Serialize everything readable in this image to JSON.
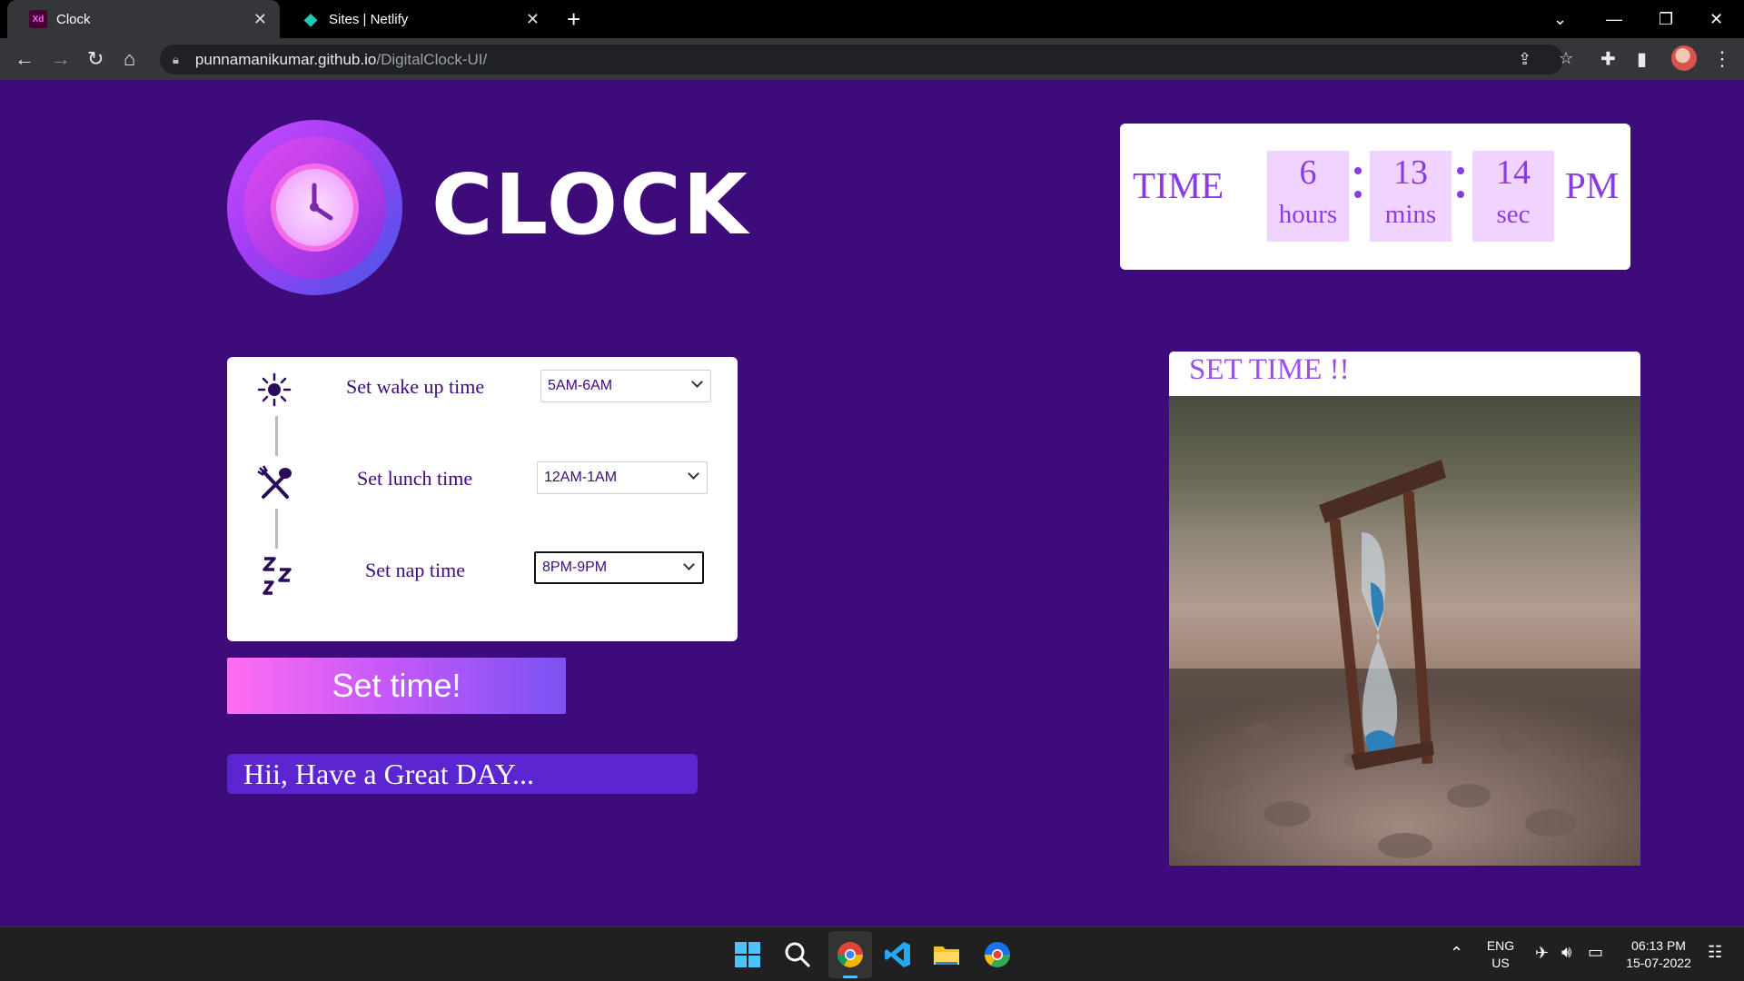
{
  "browser": {
    "tabs": [
      {
        "title": "Clock",
        "favicon": "Xd",
        "active": true
      },
      {
        "title": "Sites | Netlify",
        "active": false
      }
    ],
    "url_host": "punnamanikumar.github.io",
    "url_path": "/DigitalClock-UI/"
  },
  "header": {
    "logo_text": "CLOCK"
  },
  "clock": {
    "label": "TIME",
    "hours": "6",
    "hours_unit": "hours",
    "mins": "13",
    "mins_unit": "mins",
    "secs": "14",
    "secs_unit": "sec",
    "ampm": "PM"
  },
  "form": {
    "wake_label": "Set wake up time",
    "wake_value": "5AM-6AM",
    "lunch_label": "Set lunch time",
    "lunch_value": "12AM-1AM",
    "nap_label": "Set nap time",
    "nap_value": "8PM-9PM"
  },
  "set_button": "Set time!",
  "greeting": "Hii, Have a Great DAY...",
  "set_time_title": "SET TIME !!",
  "taskbar": {
    "lang_top": "ENG",
    "lang_bottom": "US",
    "time": "06:13 PM",
    "date": "15-07-2022"
  },
  "colors": {
    "page_bg": "#3e0b7a",
    "accent_purple": "#8a3ce0",
    "button_gradient_start": "#ff6df2",
    "button_gradient_end": "#7a52f3"
  }
}
